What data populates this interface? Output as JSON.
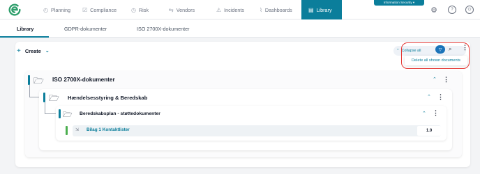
{
  "nav": {
    "items": [
      {
        "label": "Planning",
        "icon": "gauge-icon"
      },
      {
        "label": "Compliance",
        "icon": "checklist-icon"
      },
      {
        "label": "Risk",
        "icon": "clock-icon"
      },
      {
        "label": "Vendors",
        "icon": "handshake-icon"
      },
      {
        "label": "Incidents",
        "icon": "warning-icon"
      },
      {
        "label": "Dashboards",
        "icon": "chart-icon"
      },
      {
        "label": "Library",
        "icon": "book-icon"
      }
    ],
    "active": "Library",
    "workspace": "Information Security ▾",
    "accent_color": "#0b7e9b"
  },
  "tabs": [
    "Library",
    "GDPR-dokumenter",
    "ISO 2700X-dokumenter"
  ],
  "toolbar": {
    "create_label": "Create",
    "collapse_all": "Collapse all",
    "menu_item": "Delete all shown documents"
  },
  "tree": {
    "level1": "ISO 2700X-dokumenter",
    "level2": "Hændelsesstyring & Beredskab",
    "level3": "Beredskabsplan - støttedokumenter",
    "doc": {
      "title": "Bilag 1 Kontaktlister",
      "version": "1.0"
    }
  }
}
